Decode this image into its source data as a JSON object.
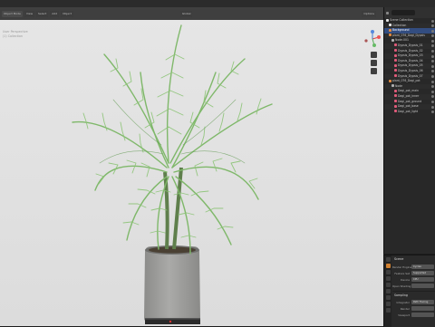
{
  "header": {
    "left_tabs": [
      "Object Mode",
      "View",
      "Select",
      "Add",
      "Object"
    ],
    "shading_label": "Global",
    "right_tools": [
      "Options"
    ]
  },
  "viewport_overlay": [
    "User Perspective",
    "(1) Collection"
  ],
  "outliner": {
    "title": "Scene Collection",
    "rows": [
      {
        "label": "Scene Collection",
        "depth": 0,
        "icon": "collection-icon",
        "highlight": false
      },
      {
        "label": "Collection",
        "depth": 1,
        "icon": "collection-icon",
        "highlight": false
      },
      {
        "label": "Background",
        "depth": 1,
        "icon": "object-icon",
        "highlight": true
      },
      {
        "label": "plant_076_Dagi_Dypsis",
        "depth": 1,
        "icon": "object-icon",
        "highlight": false
      },
      {
        "label": "Node.001",
        "depth": 2,
        "icon": "empty-icon",
        "highlight": false
      },
      {
        "label": "Dypsis_Dypsis_01",
        "depth": 3,
        "icon": "mesh-icon",
        "highlight": false
      },
      {
        "label": "Dypsis_Dypsis_02",
        "depth": 3,
        "icon": "mesh-icon",
        "highlight": false
      },
      {
        "label": "Dypsis_Dypsis_03",
        "depth": 3,
        "icon": "mesh-icon",
        "highlight": false
      },
      {
        "label": "Dypsis_Dypsis_04",
        "depth": 3,
        "icon": "mesh-icon",
        "highlight": false
      },
      {
        "label": "Dypsis_Dypsis_05",
        "depth": 3,
        "icon": "mesh-icon",
        "highlight": false
      },
      {
        "label": "Dypsis_Dypsis_06",
        "depth": 3,
        "icon": "mesh-icon",
        "highlight": false
      },
      {
        "label": "Dypsis_Dypsis_07",
        "depth": 3,
        "icon": "mesh-icon",
        "highlight": false
      },
      {
        "label": "plant_076_Dagi_pot",
        "depth": 1,
        "icon": "object-icon",
        "highlight": false
      },
      {
        "label": "Node",
        "depth": 2,
        "icon": "empty-icon",
        "highlight": false
      },
      {
        "label": "Dagi_pot_main",
        "depth": 3,
        "icon": "mesh-icon",
        "highlight": false
      },
      {
        "label": "Dagi_pot_inner",
        "depth": 3,
        "icon": "mesh-icon",
        "highlight": false
      },
      {
        "label": "Dagi_pot_ground",
        "depth": 3,
        "icon": "mesh-icon",
        "highlight": false
      },
      {
        "label": "Dagi_pot_base",
        "depth": 3,
        "icon": "mesh-icon",
        "highlight": false
      },
      {
        "label": "Dagi_pot_light",
        "depth": 3,
        "icon": "mesh-icon",
        "highlight": false
      }
    ]
  },
  "properties": {
    "title": "Scene",
    "rows": [
      {
        "label": "Render Engine",
        "value": "Cycles"
      },
      {
        "label": "Feature Set",
        "value": "Supported"
      },
      {
        "label": "Device",
        "value": "CPU"
      },
      {
        "label": "Open Shading",
        "value": ""
      }
    ],
    "section": "Sampling",
    "section_rows": [
      {
        "label": "Integrator",
        "value": "Path Tracing"
      },
      {
        "label": "Render",
        "value": ""
      },
      {
        "label": "Viewport",
        "value": ""
      }
    ]
  },
  "colors": {
    "accent": "#d08030",
    "selection": "#334d80",
    "leaf": "#7fb86a",
    "pot": "#9e9e9c"
  }
}
